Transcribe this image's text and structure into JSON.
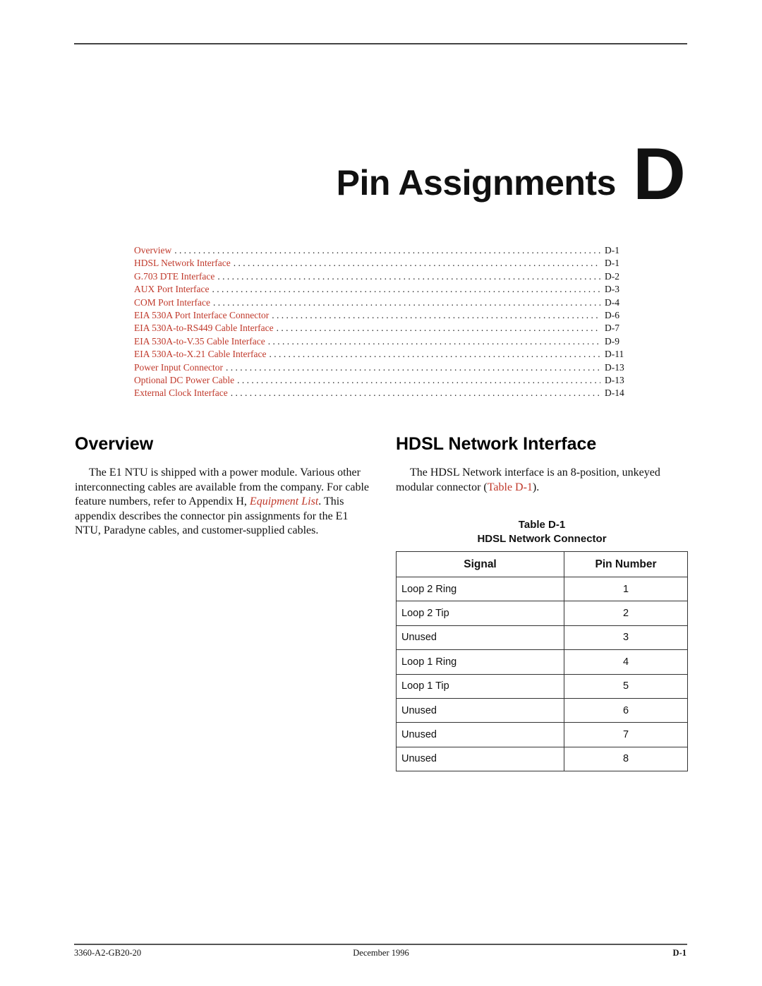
{
  "header": {
    "chapter_title": "Pin Assignments",
    "chapter_letter": "D"
  },
  "toc": {
    "link_color": "#c0392b",
    "entries": [
      {
        "label": "Overview",
        "page": "D-1"
      },
      {
        "label": "HDSL Network Interface",
        "page": "D-1"
      },
      {
        "label": "G.703 DTE Interface",
        "page": "D-2"
      },
      {
        "label": "AUX Port Interface",
        "page": "D-3"
      },
      {
        "label": "COM Port Interface",
        "page": "D-4"
      },
      {
        "label": "EIA 530A Port Interface Connector",
        "page": "D-6"
      },
      {
        "label": "EIA 530A-to-RS449 Cable Interface",
        "page": "D-7"
      },
      {
        "label": "EIA 530A-to-V.35 Cable Interface",
        "page": "D-9"
      },
      {
        "label": "EIA 530A-to-X.21 Cable Interface",
        "page": "D-11"
      },
      {
        "label": "Power Input Connector",
        "page": "D-13"
      },
      {
        "label": "Optional DC Power Cable",
        "page": "D-13"
      },
      {
        "label": "External Clock Interface",
        "page": "D-14"
      }
    ]
  },
  "overview": {
    "heading": "Overview",
    "text_before_link": "The E1 NTU is shipped with a power module. Various other interconnecting cables are available from the company. For cable feature numbers, refer to Appendix H, ",
    "link_text": "Equipment List",
    "text_after_link": ". This appendix describes the connector pin assignments for the E1 NTU, Paradyne cables, and customer-supplied cables."
  },
  "hdsl": {
    "heading": "HDSL Network Interface",
    "text_before_link": "The HDSL Network interface is an 8-position, unkeyed modular connector (",
    "link_text": "Table D-1",
    "text_after_link": ").",
    "table": {
      "caption_number": "Table D-1",
      "caption_title": "HDSL Network Connector",
      "headers": [
        "Signal",
        "Pin Number"
      ],
      "rows": [
        {
          "signal": "Loop 2 Ring",
          "pin": "1"
        },
        {
          "signal": "Loop 2 Tip",
          "pin": "2"
        },
        {
          "signal": "Unused",
          "pin": "3"
        },
        {
          "signal": "Loop 1 Ring",
          "pin": "4"
        },
        {
          "signal": "Loop 1 Tip",
          "pin": "5"
        },
        {
          "signal": "Unused",
          "pin": "6"
        },
        {
          "signal": "Unused",
          "pin": "7"
        },
        {
          "signal": "Unused",
          "pin": "8"
        }
      ]
    }
  },
  "footer": {
    "doc_number": "3360-A2-GB20-20",
    "date": "December 1996",
    "page": "D-1"
  }
}
